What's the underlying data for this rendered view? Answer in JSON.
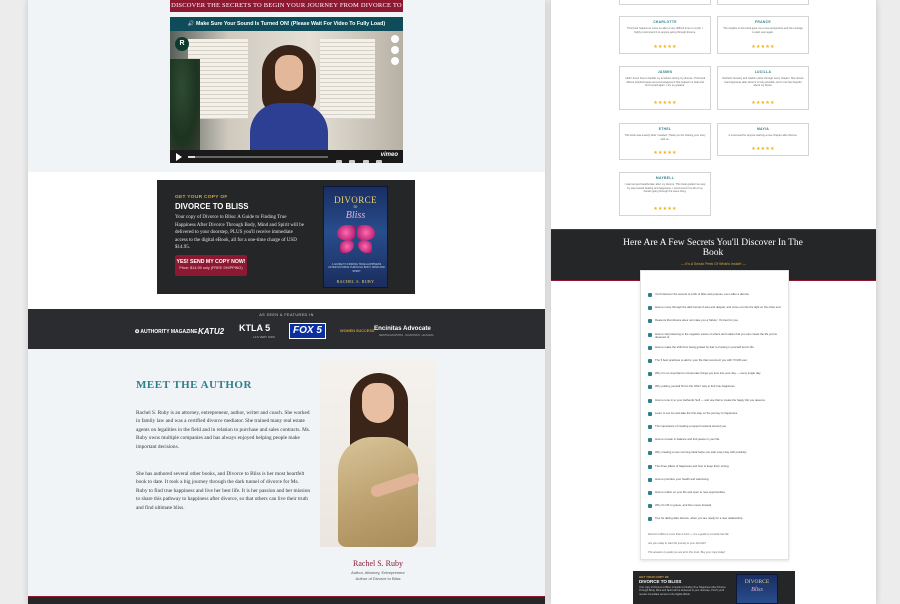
{
  "hero": {
    "banner": "DISCOVER THE SECRETS TO BEGIN YOUR JOURNEY FROM DIVORCE TO BLISS",
    "video_notice": "🔊 Make Sure Your Sound Is Turned ON! (Please Wait For Video To Fully Load)",
    "video_logo": "R",
    "vimeo_label": "vimeo",
    "progress_fraction": 0.05
  },
  "book_promo": {
    "kicker": "GET YOUR COPY OF",
    "title": "DIVORCE TO BLISS",
    "body": "Your copy of Divorce to Bliss: A Guide to Finding True Happiness After Divorce Through Body, Mind and Spirit will be delivered to your doorstep, PLUS you'll receive immediate access to the digital eBook, all for a one-time charge of USD $14.95.",
    "button_label": "YES! SEND MY COPY NOW!",
    "button_sub": "Price: $14.95 only (FREE SHIPPING)",
    "cover": {
      "title": "DIVORCE",
      "to": "to",
      "bliss": "Bliss",
      "subtitle": "A GUIDE TO FINDING TRUE HAPPINESS AFTER DIVORCE THROUGH BODY, MIND AND SPIRIT",
      "author": "RACHEL S. RUBY"
    }
  },
  "as_seen": {
    "label": "AS SEEN & FEATURED IN",
    "logos": {
      "authority": "✪ AUTHORITY MAGAZINE",
      "katu": "KATU2",
      "ktla": "KTLA 5",
      "ktla_sub": "LA'S VERY OWN",
      "fox": "FOX 5",
      "ws": "WOMEN SUCCESS",
      "encinitas": "Encinitas Advocate",
      "encinitas_sub": "SERVING ENCINITAS · OLIVENHAIN · LEUCADIA"
    }
  },
  "author": {
    "heading": "MEET THE AUTHOR",
    "bio1": "Rachel S. Ruby is an attorney, entrepreneur, author, writer and coach. She worked in family law and was a certified divorce mediator. She trained many real estate agents on legalities in the field and in relation to purchase and sales contracts. Ms. Ruby owns multiple companies and has always enjoyed helping people make important decisions.",
    "bio2": "She has authored several other books, and Divorce to Bliss is her most heartfelt book to date. It took a big journey through the dark tunnel of divorce for Ms. Ruby to find true happiness and live her best life. It is her passion and her mission to share this pathway to happiness after divorce, so that others can live their truth and find ultimate bliss.",
    "signature": "Rachel S. Ruby",
    "role": "Author, Attorney, Entrepreneur",
    "role2": "Author of Divorce to Bliss"
  },
  "testimonials": [
    {
      "name": "",
      "text": "",
      "stars": "★★★★★"
    },
    {
      "name": "",
      "text": "",
      "stars": "★★★★★"
    },
    {
      "name": "CHARLOTTE",
      "text": "This book helped me move on after a very difficult time in my life. I highly recommend it to anyone going through divorce.",
      "stars": "★★★★★"
    },
    {
      "name": "FRANCE",
      "text": "The insights in this book gave me a new perspective and the courage to start over again.",
      "stars": "★★★★★"
    },
    {
      "name": "JASMIN",
      "text": "I didn't know how to handle my emotions during my divorce. This book offered practical steps and encouragement that helped me heal and find myself again. I am so grateful.",
      "stars": "★★★★★"
    },
    {
      "name": "LUCILLA",
      "text": "Rachel's honesty and wisdom shine through every chapter. She shows that happiness after divorce is truly possible, and I now feel hopeful about my future.",
      "stars": "★★★★★"
    },
    {
      "name": "ETHEL",
      "text": "This book was exactly what I needed. Thank you for sharing your story with us.",
      "stars": "★★★★★"
    },
    {
      "name": "MAYIA",
      "text": "A must-read for anyone starting a new chapter after divorce.",
      "stars": "★★★★★"
    },
    {
      "name": "MAYBELL",
      "text": "I was lost and heartbroken after my divorce. This book guided me step by step toward healing and happiness. I recommend it to all of my friends going through the same thing.",
      "stars": "★★★★★"
    }
  ],
  "secrets": {
    "title": "Here Are A Few Secrets You'll Discover In The Book",
    "subtitle": "— It's A Sneak Peek Of What's Inside! —",
    "bullets": [
      "You'll discover the secrets to a life of bliss and purpose, even after a divorce.",
      "How to move through the dark tunnel of loss and despair, and come out into the light on the other end.",
      "Reasons that divorce does not make you a 'failure'. It's best for you.",
      "How to stop listening to the negative voices of others and realize that you can create the life you've dreamed of.",
      "How to make the shift from being guided by fear to trusting in yourself and in life.",
      "The 5 best practices to add to your life that reconnect you with YOUR soul.",
      "Why it is so important to incorporate things you love into your day — every single day.",
      "Why putting yourself first is the ONLY way to find true happiness.",
      "How to tune in to your Authentic Self — and use that to create the happy life you deserve.",
      "Learn to Let Go and take the first step on the journey to happiness.",
      "The importance of creating a support network around you.",
      "How to remain in balance and find peace in your life.",
      "Why creating a new morning ritual helps you start every day with positivity.",
      "The three pillars of happiness and how to keep them strong.",
      "How to prioritize your health and well-being.",
      "How to reflect on your life and open to new opportunities.",
      "Why it's OK to grieve, and then move forward.",
      "Tips for dating after divorce, when you are ready for a new relationship."
    ],
    "foot1": "Divorce to Bliss is more than a book — it is a guide to a brand new life.",
    "foot2": "Are you ready to start the journey to your best life?",
    "foot3": "The answers to guide you are all in this book. Buy your copy today!"
  },
  "right_promo": {
    "kicker": "GET YOUR COPY OF",
    "title": "DIVORCE TO BLISS",
    "text": "Your copy of Divorce to Bliss: A Guide to Finding True Happiness After Divorce Through Body, Mind and Spirit will be delivered to your doorstep, PLUS you'll receive immediate access to the digital eBook.",
    "cover_title": "DIVORCE",
    "cover_bliss": "Bliss"
  }
}
